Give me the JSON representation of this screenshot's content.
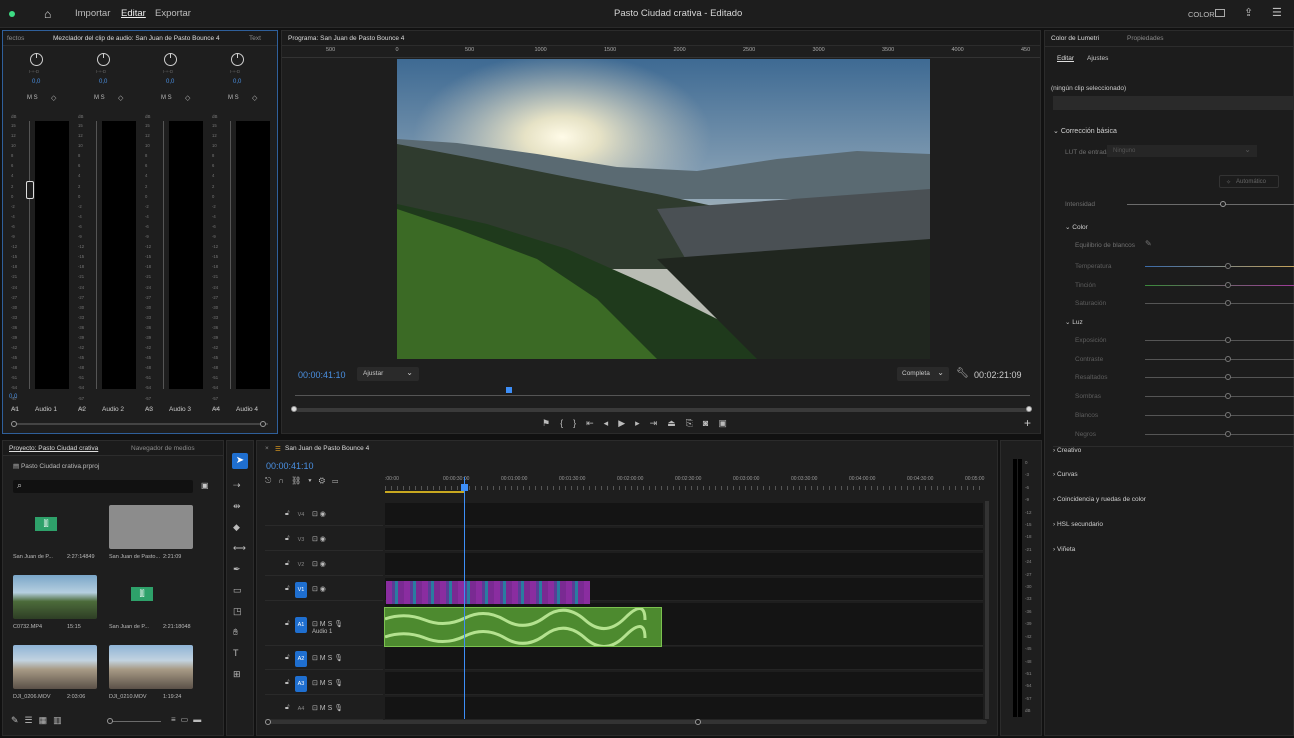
{
  "app": {
    "title": "Pasto Ciudad crativa - Editado",
    "menus": [
      "Importar",
      "Editar",
      "Exportar"
    ],
    "workspace": "COLOR"
  },
  "mixer": {
    "tabs": [
      "fectos",
      "Mezclador del clip de audio: San Juan de Pasto Bounce 4",
      "Text"
    ],
    "channels": [
      {
        "id": "A1",
        "name": "Audio 1"
      },
      {
        "id": "A2",
        "name": "Audio 2"
      },
      {
        "id": "A3",
        "name": "Audio 3"
      },
      {
        "id": "A4",
        "name": "Audio 4"
      }
    ],
    "gain": "0,0",
    "pan_label": "I-+-D",
    "msr": "M S",
    "db_label": "dB",
    "scale": [
      "15",
      "12",
      "10",
      "8",
      "6",
      "4",
      "2",
      "0",
      "-2",
      "-4",
      "-6",
      "-9",
      "-12",
      "-15",
      "-18",
      "-21",
      "-24",
      "-27",
      "-30",
      "-33",
      "-36",
      "-39",
      "-42",
      "-45",
      "-48",
      "-51",
      "-54",
      "-57",
      "-60"
    ],
    "master_val": "0,0"
  },
  "program": {
    "tab": "Programa: San Juan de Pasto Bounce 4",
    "ruler": [
      "500",
      "0",
      "500",
      "1000",
      "1500",
      "2000",
      "2500",
      "3000",
      "3500",
      "4000",
      "450"
    ],
    "timecode": "00:00:41:10",
    "fit": "Ajustar",
    "quality": "Completa",
    "duration": "00:02:21:09"
  },
  "lumetri": {
    "tabs": [
      "Color de Lumetri",
      "Propiedades"
    ],
    "subtabs": [
      "Editar",
      "Ajustes"
    ],
    "no_clip": "(ningún clip seleccionado)",
    "basic": "Corrección básica",
    "lut_label": "LUT de entrada",
    "lut_value": "Ninguno",
    "auto": "Automático",
    "intensity": "Intensidad",
    "color": "Color",
    "white_balance": "Equilibrio de blancos",
    "color_sliders": [
      "Temperatura",
      "Tinción",
      "Saturación"
    ],
    "light": "Luz",
    "light_sliders": [
      "Exposición",
      "Contraste",
      "Resaltados",
      "Sombras",
      "Blancos",
      "Negros"
    ],
    "sections": [
      "Creativo",
      "Curvas",
      "Coincidencia y ruedas de color",
      "HSL secundario",
      "Viñeta"
    ]
  },
  "project": {
    "tabs": [
      "Proyecto: Pasto Ciudad crativa",
      "Navegador de medios"
    ],
    "file": "Pasto Ciudad crativa.prproj",
    "search_placeholder": "",
    "items": [
      {
        "name": "San Juan de P...",
        "dur": "2:27:14849"
      },
      {
        "name": "San Juan de Pasto...",
        "dur": "2:21:09"
      },
      {
        "name": "C0732.MP4",
        "dur": "15:15"
      },
      {
        "name": "San Juan de P...",
        "dur": "2:21:18048"
      },
      {
        "name": "DJI_0206.MOV",
        "dur": "2:03:06"
      },
      {
        "name": "DJI_0210.MOV",
        "dur": "1:19:24"
      }
    ]
  },
  "timeline": {
    "tab": "San Juan de Pasto Bounce 4",
    "timecode": "00:00:41:10",
    "ruler": [
      ":00:00",
      "00:00:30:00",
      "00:01:00:00",
      "00:01:30:00",
      "00:02:00:00",
      "00:02:30:00",
      "00:03:00:00",
      "00:03:30:00",
      "00:04:00:00",
      "00:04:30:00",
      "00:05:00"
    ],
    "tracks": [
      {
        "id": "V4",
        "label": ""
      },
      {
        "id": "V3",
        "label": ""
      },
      {
        "id": "V2",
        "label": ""
      },
      {
        "id": "V1",
        "label": ""
      },
      {
        "id": "A1",
        "label": "Audio 1"
      },
      {
        "id": "A2",
        "label": ""
      },
      {
        "id": "A3",
        "label": ""
      },
      {
        "id": "A4",
        "label": ""
      }
    ],
    "meter_scale": [
      "0",
      "-3",
      "-6",
      "-9",
      "-12",
      "-15",
      "-18",
      "-21",
      "-24",
      "-27",
      "-30",
      "-33",
      "-36",
      "-39",
      "-42",
      "-45",
      "-48",
      "-51",
      "-54",
      "-57",
      "dB"
    ]
  },
  "colors": {
    "accent": "#1f6fd0",
    "clip_video": "#8a2da0",
    "clip_audio": "#5b9b3a",
    "playhead": "#3d8ef7"
  }
}
